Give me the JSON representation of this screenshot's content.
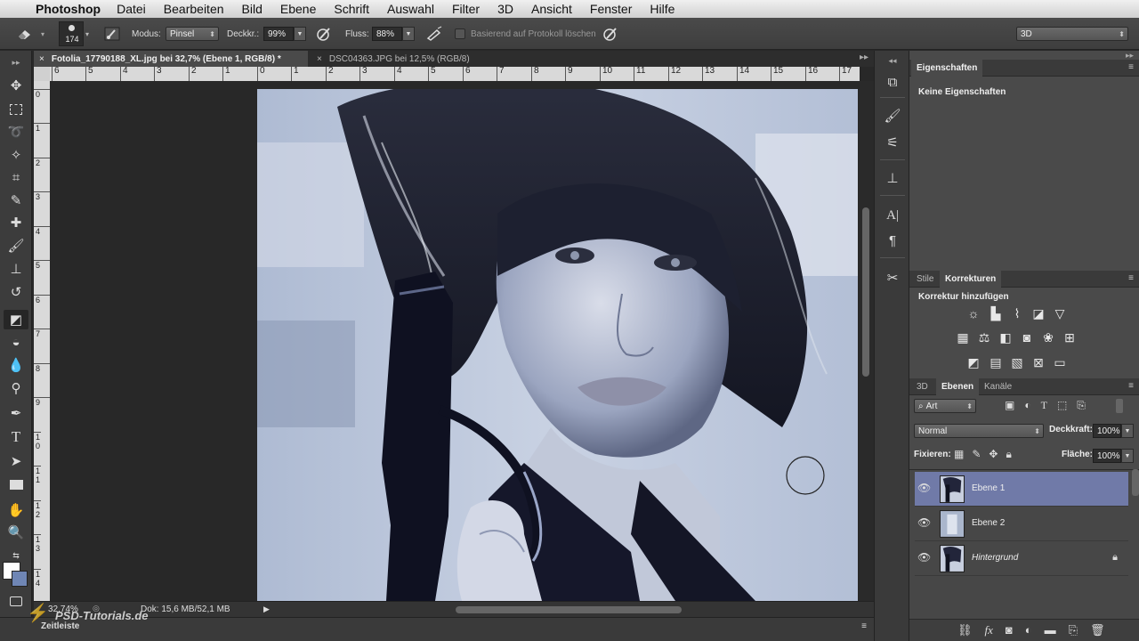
{
  "menubar": {
    "apple_glyph": "",
    "app": "Photoshop",
    "items": [
      "Datei",
      "Bearbeiten",
      "Bild",
      "Ebene",
      "Schrift",
      "Auswahl",
      "Filter",
      "3D",
      "Ansicht",
      "Fenster",
      "Hilfe"
    ]
  },
  "options": {
    "brush_size": "174",
    "modus_label": "Modus:",
    "modus_value": "Pinsel",
    "deckkr_label": "Deckkr.:",
    "deckkr_value": "99%",
    "fluss_label": "Fluss:",
    "fluss_value": "88%",
    "protokoll_label": "Basierend auf Protokoll löschen",
    "workspace": "3D"
  },
  "tabs": [
    {
      "label": "Fotolia_17790188_XL.jpg bei 32,7% (Ebene 1, RGB/8) *",
      "active": true
    },
    {
      "label": "DSC04363.JPG bei 12,5% (RGB/8)",
      "active": false
    }
  ],
  "ruler": {
    "h": [
      "6",
      "5",
      "4",
      "3",
      "2",
      "1",
      "0",
      "1",
      "2",
      "3",
      "4",
      "5",
      "6",
      "7",
      "8",
      "9",
      "10",
      "11",
      "12",
      "13",
      "14",
      "15",
      "16",
      "17"
    ],
    "v": [
      "0",
      "1",
      "2",
      "3",
      "4",
      "5",
      "6",
      "7",
      "8",
      "9",
      "1 0",
      "1 1",
      "1 2",
      "1 3",
      "1 4"
    ]
  },
  "status": {
    "zoom": "32,74%",
    "doc": "Dok: 15,6 MB/52,1 MB",
    "watermark": "PSD-Tutorials.de"
  },
  "timeline": {
    "label": "Zeitleiste"
  },
  "properties": {
    "tab": "Eigenschaften",
    "content": "Keine Eigenschaften"
  },
  "adjustments": {
    "tabs": [
      "Stile",
      "Korrekturen"
    ],
    "title": "Korrektur hinzufügen",
    "icons_row1": [
      "brightness-icon",
      "levels-icon",
      "curves-icon",
      "exposure-icon",
      "gradient-triangle-icon"
    ],
    "icons_row2": [
      "vibrance-icon",
      "color-balance-icon",
      "black-white-icon",
      "photo-filter-icon",
      "channel-mixer-icon",
      "color-lookup-icon"
    ],
    "icons_row3": [
      "invert-icon",
      "posterize-icon",
      "threshold-icon",
      "selective-color-icon",
      "gradient-map-icon"
    ]
  },
  "layers_panel": {
    "tabs": [
      "3D",
      "Ebenen",
      "Kanäle"
    ],
    "filter": "Art",
    "blend_mode": "Normal",
    "deckkraft_label": "Deckkraft:",
    "deckkraft_value": "100%",
    "fixieren_label": "Fixieren:",
    "flaeche_label": "Fläche:",
    "flaeche_value": "100%",
    "layers": [
      {
        "name": "Ebene 1",
        "selected": true,
        "italic": false,
        "locked": false
      },
      {
        "name": "Ebene 2",
        "selected": false,
        "italic": false,
        "locked": false
      },
      {
        "name": "Hintergrund",
        "selected": false,
        "italic": true,
        "locked": true
      }
    ]
  },
  "colors": {
    "accent_selected_layer": "#707aa8",
    "panel_bg": "#4a4a4a",
    "canvas_bg": "#282828"
  }
}
